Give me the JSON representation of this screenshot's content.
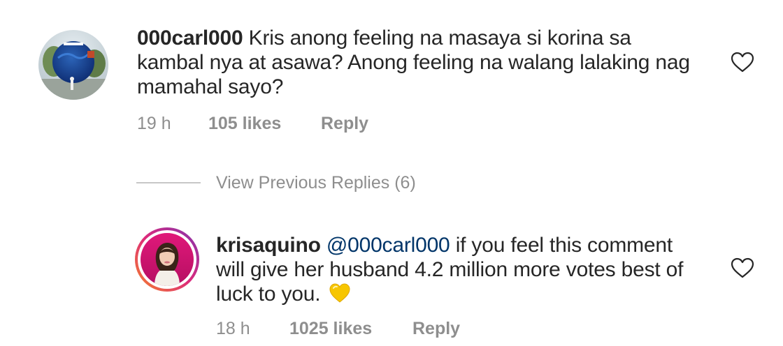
{
  "comment": {
    "username": "000carl000",
    "text": "Kris anong feeling na masaya si korina sa kambal nya at asawa? Anong feeling na walang lalaking nag mamahal sayo?",
    "line1": "Kris anong feeling na masaya si korina sa",
    "line2": "kambal nya at asawa? Anong feeling na walang lalaking nag",
    "line3": "mamahal sayo?",
    "time": "19 h",
    "likes": "105 likes",
    "reply_label": "Reply",
    "avatar_icon": "profile-photo-globe-icon",
    "like_icon": "heart-outline-icon"
  },
  "view_previous_replies": "View Previous Replies (6)",
  "reply": {
    "username": "krisaquino",
    "mention": "@000carl000",
    "text": "if you feel this comment will give her husband 4.2 million more votes best of luck to you.",
    "line1": "if you feel this comment",
    "line2": "will give her husband 4.2 million more votes best of",
    "line3": "luck to you.",
    "emoji": "yellow-heart-emoji",
    "time": "18 h",
    "likes": "1025 likes",
    "reply_label": "Reply",
    "avatar_icon": "profile-photo-woman-icon",
    "like_icon": "heart-outline-icon",
    "story_ring_colors": [
      "#f58529",
      "#dd2a7b",
      "#8134af"
    ]
  },
  "colors": {
    "text": "#262626",
    "meta": "#8e8e8e",
    "mention": "#003569",
    "divider": "#c7c7c7",
    "emoji_heart": "#f7c600"
  }
}
